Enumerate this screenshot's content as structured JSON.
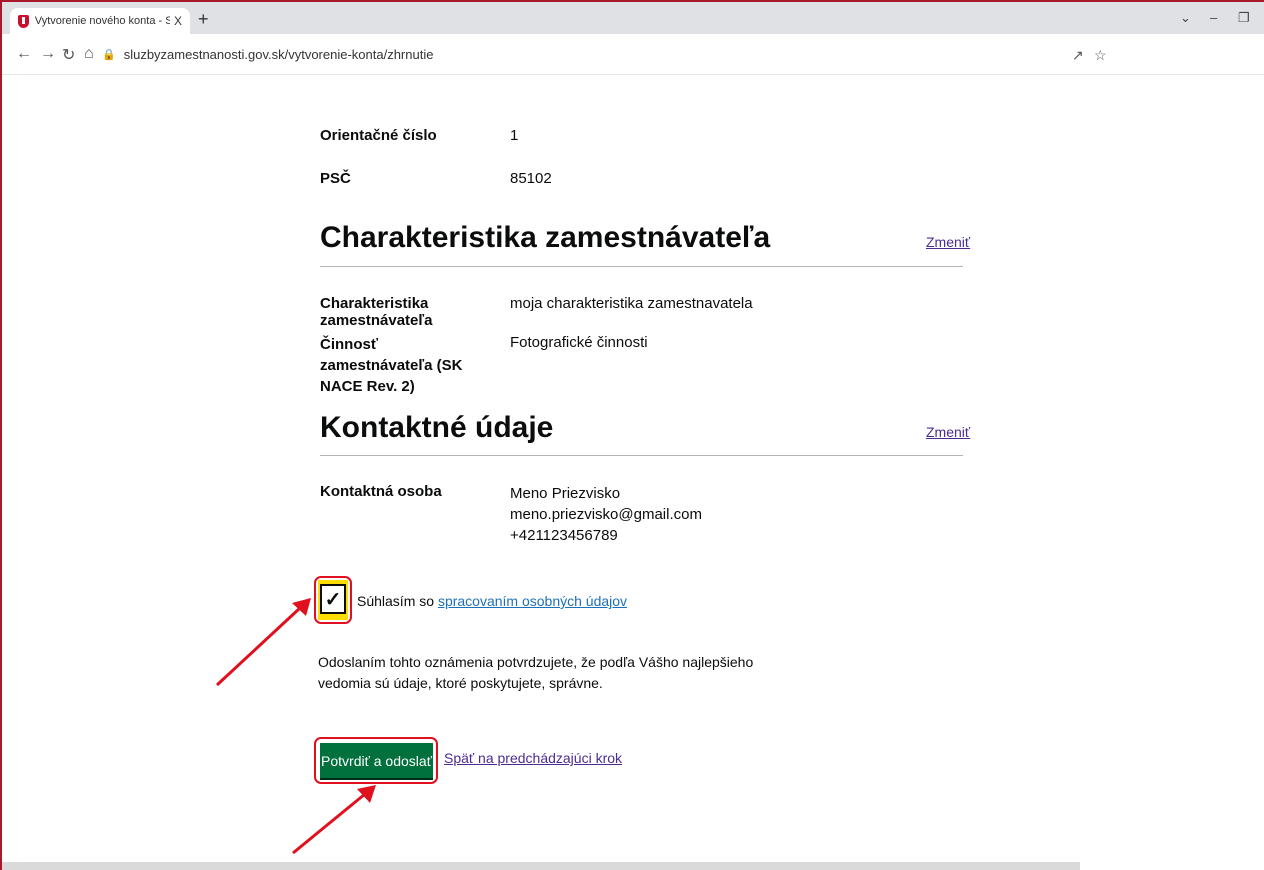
{
  "browser": {
    "tab_title": "Vytvorenie nového konta - Služb",
    "tab_close": "X",
    "new_tab": "+",
    "url": "sluzbyzamestnanosti.gov.sk/vytvorenie-konta/zhrnutie",
    "window_controls": [
      "⌄",
      "–",
      "❐"
    ]
  },
  "address": {
    "rows": [
      {
        "label": "Orientačné číslo",
        "value": "1"
      },
      {
        "label": "PSČ",
        "value": "85102"
      }
    ]
  },
  "employer": {
    "heading": "Charakteristika zamestnávateľa",
    "change_label": "Zmeniť",
    "rows": [
      {
        "label": "Charakteristika zamestnávateľa",
        "value": "moja charakteristika zamestnavatela"
      },
      {
        "label": "Činnosť zamestnávateľa (SK NACE Rev. 2)",
        "value": "Fotografické činnosti"
      }
    ]
  },
  "contact": {
    "heading": "Kontaktné údaje",
    "change_label": "Zmeniť",
    "label": "Kontaktná osoba",
    "name": "Meno Priezvisko",
    "email": "meno.priezvisko@gmail.com",
    "phone": "+421123456789"
  },
  "consent": {
    "checked": true,
    "check_mark": "✓",
    "text": "Súhlasím so",
    "link": "spracovaním osobných údajov"
  },
  "declaration": "Odoslaním tohto oznámenia potvrdzujete, že podľa Vášho najlepšieho vedomia sú údaje, ktoré poskytujete, správne.",
  "actions": {
    "submit_label": "Potvrdiť a odoslať",
    "back_label": "Späť na predchádzajúci krok"
  },
  "colors": {
    "submit_button": "#00703c",
    "annotation": "#e0101e",
    "checkbox_focus": "#ffdd00"
  }
}
